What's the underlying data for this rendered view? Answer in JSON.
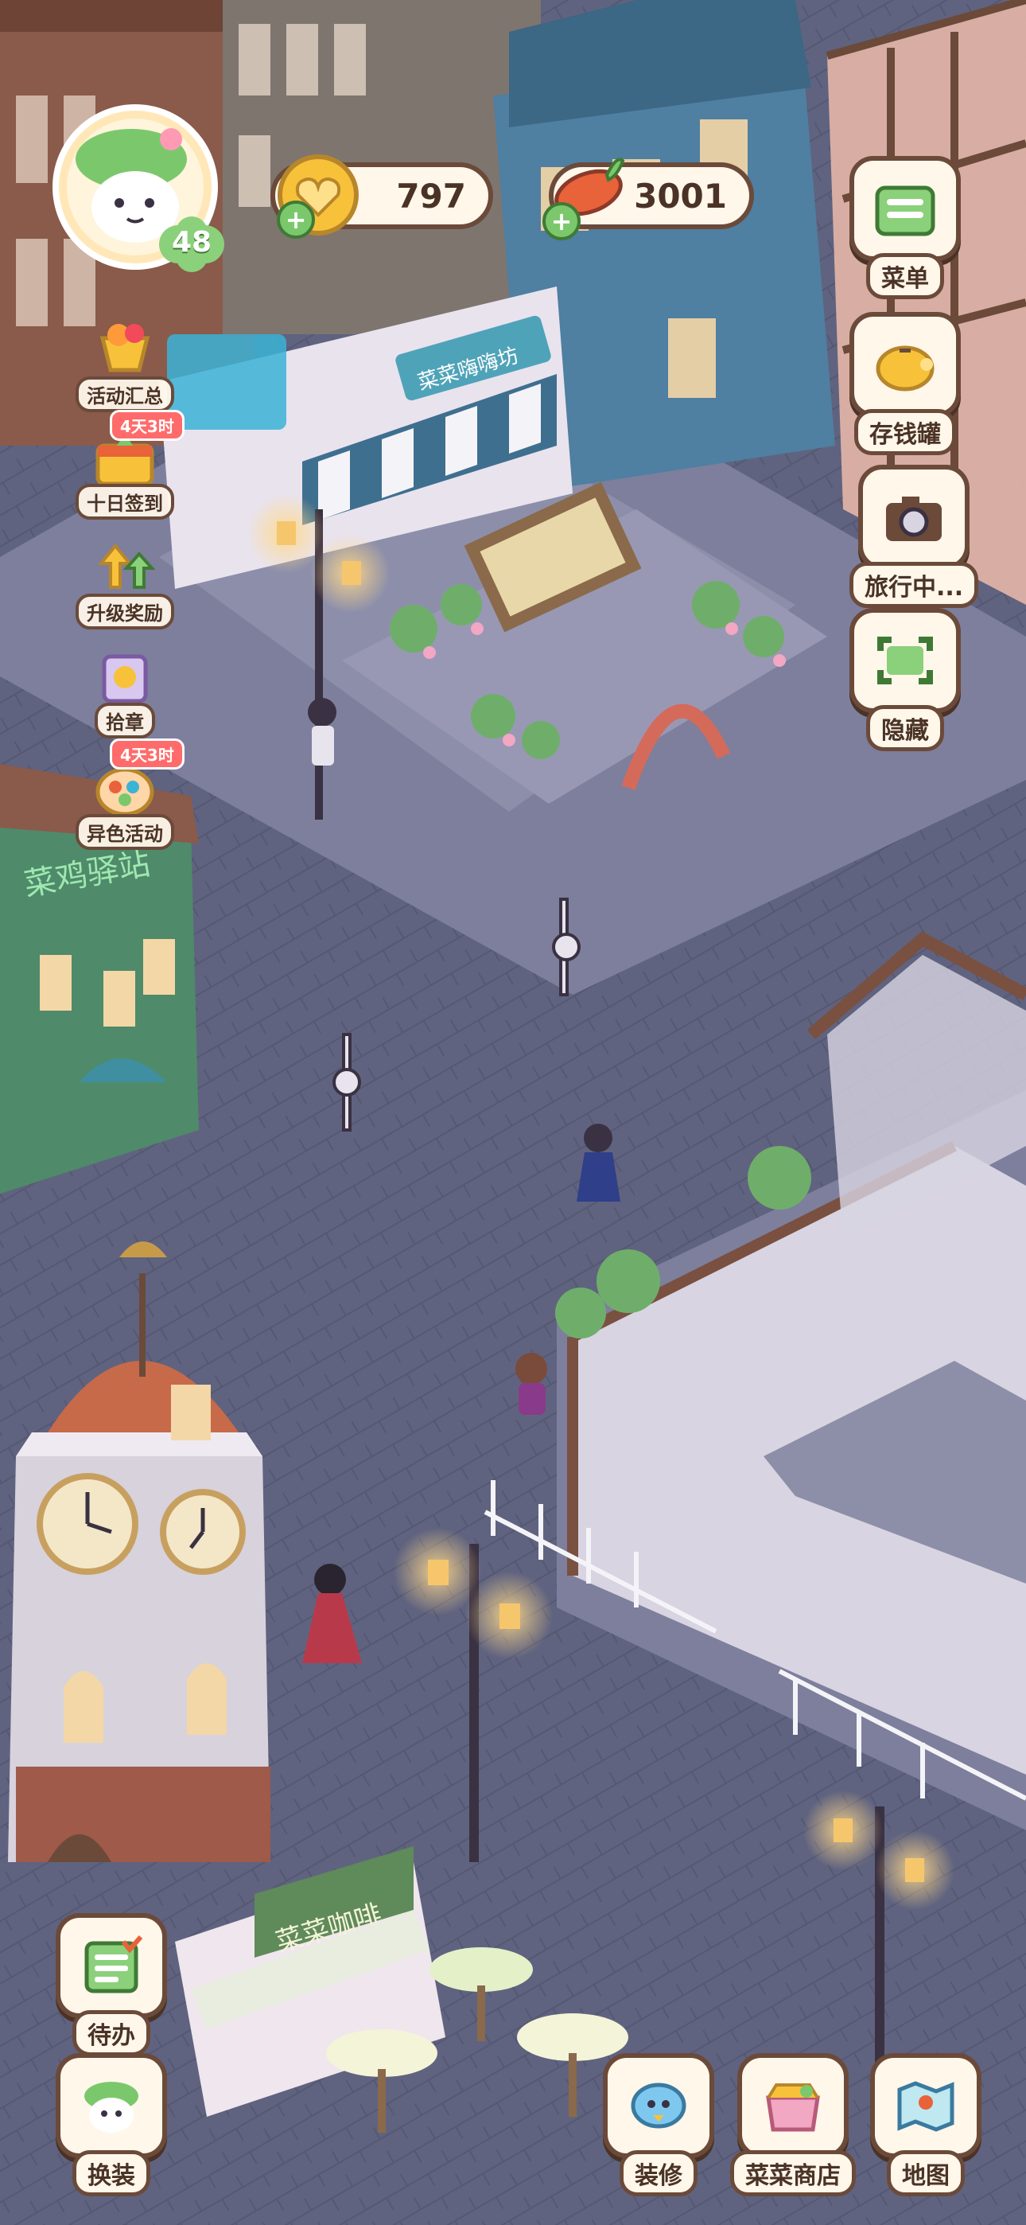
{
  "player": {
    "level": "48"
  },
  "resources": {
    "coins": {
      "value": "797",
      "icon": "heart-coin-icon"
    },
    "veggies": {
      "value": "3001",
      "icon": "carrot-icon"
    }
  },
  "events": [
    {
      "label": "活动汇总",
      "icon": "trophy-fruit-icon",
      "timer": ""
    },
    {
      "label": "十日签到",
      "icon": "calendar-gift-icon",
      "timer": "4天3时"
    },
    {
      "label": "升级奖励",
      "icon": "level-up-arrows-icon",
      "timer": ""
    },
    {
      "label": "拾章",
      "icon": "stamp-gift-icon",
      "timer": ""
    },
    {
      "label": "异色活动",
      "icon": "color-event-icon",
      "timer": "4天3时"
    }
  ],
  "right_menu": [
    {
      "label": "菜单",
      "icon": "menu-box-icon"
    },
    {
      "label": "存钱罐",
      "icon": "piggy-bank-icon"
    },
    {
      "label": "旅行中...",
      "icon": "camera-icon"
    },
    {
      "label": "隐藏",
      "icon": "hide-frame-icon"
    }
  ],
  "bottom_left": [
    {
      "label": "待办",
      "icon": "todo-list-icon"
    },
    {
      "label": "换装",
      "icon": "outfit-icon"
    }
  ],
  "bottom_right": [
    {
      "label": "装修",
      "icon": "decorate-icon"
    },
    {
      "label": "菜菜商店",
      "icon": "shop-icon"
    },
    {
      "label": "地图",
      "icon": "map-icon"
    }
  ],
  "signs": {
    "cafe_sign": "菜菜咖啡",
    "station_sign": "菜鸡驿站",
    "shop_sign": "菜菜嗨嗨坊"
  },
  "colors": {
    "ui_border": "#6b4a3a",
    "ui_bg": "#fff7ea",
    "accent_green": "#7bc86c",
    "timer_red": "#ff6b6b"
  }
}
